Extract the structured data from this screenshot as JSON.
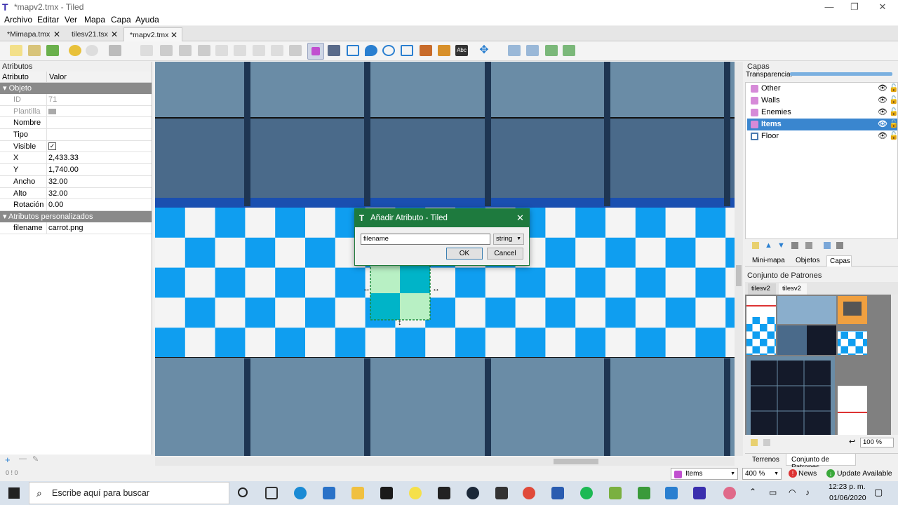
{
  "window": {
    "title": "*mapv2.tmx - Tiled",
    "controls": [
      "—",
      "❐",
      "✕"
    ]
  },
  "menu": [
    {
      "label": "Archivo"
    },
    {
      "label": "Editar"
    },
    {
      "label": "Ver"
    },
    {
      "label": "Mapa"
    },
    {
      "label": "Capa"
    },
    {
      "label": "Ayuda"
    }
  ],
  "tabs": [
    {
      "label": "*Mimapa.tmx",
      "close": "✕"
    },
    {
      "label": "tilesv21.tsx",
      "close": "✕"
    },
    {
      "label": "*mapv2.tmx",
      "close": "✕"
    }
  ],
  "attributes": {
    "panel_title": "Atributos",
    "col_name": "Atributo",
    "col_value": "Valor",
    "group_object": "Objeto",
    "rows": [
      {
        "key": "ID",
        "value": "71"
      },
      {
        "key": "Plantilla",
        "value": ""
      },
      {
        "key": "Nombre",
        "value": ""
      },
      {
        "key": "Tipo",
        "value": ""
      },
      {
        "key": "Visible",
        "value": "✓"
      },
      {
        "key": "X",
        "value": "2,433.33"
      },
      {
        "key": "Y",
        "value": "1,740.00"
      },
      {
        "key": "Ancho",
        "value": "32.00"
      },
      {
        "key": "Alto",
        "value": "32.00"
      },
      {
        "key": "Rotación",
        "value": "0.00"
      }
    ],
    "group_custom": "Atributos personalizados",
    "custom_rows": [
      {
        "key": "filename",
        "value": "carrot.png"
      }
    ],
    "footer": [
      "+",
      "—",
      "✎"
    ],
    "status": "0 ! 0"
  },
  "dialog": {
    "title": "Añadir Atributo - Tiled",
    "name_value": "filename",
    "type_value": "string",
    "ok": "OK",
    "cancel": "Cancel",
    "close": "✕"
  },
  "layers": {
    "panel_title": "Capas",
    "opacity_label": "Transparencia:",
    "items": [
      {
        "name": "Other"
      },
      {
        "name": "Walls"
      },
      {
        "name": "Enemies"
      },
      {
        "name": "Items",
        "selected": true
      },
      {
        "name": "Floor"
      }
    ],
    "tabs": [
      "Mini-mapa",
      "Objetos",
      "Capas"
    ]
  },
  "tileset": {
    "panel_title": "Conjunto de Patrones",
    "tabs": [
      "tilesv2",
      "tilesv2"
    ],
    "zoom": "100 %",
    "bottom_tabs": [
      "Terrenos",
      "Conjunto de Patrones"
    ]
  },
  "statusbar": {
    "layer_select": "Items",
    "zoom": "400 %",
    "news": "News",
    "update": "Update Available"
  },
  "taskbar": {
    "search_placeholder": "Escribe aquí para buscar",
    "time": "12:23 p. m.",
    "date": "01/06/2020"
  },
  "colors": {
    "accent_blue": "#0f9ef0",
    "dialog_green": "#1e7a3e",
    "selection": "#3a86cf"
  }
}
